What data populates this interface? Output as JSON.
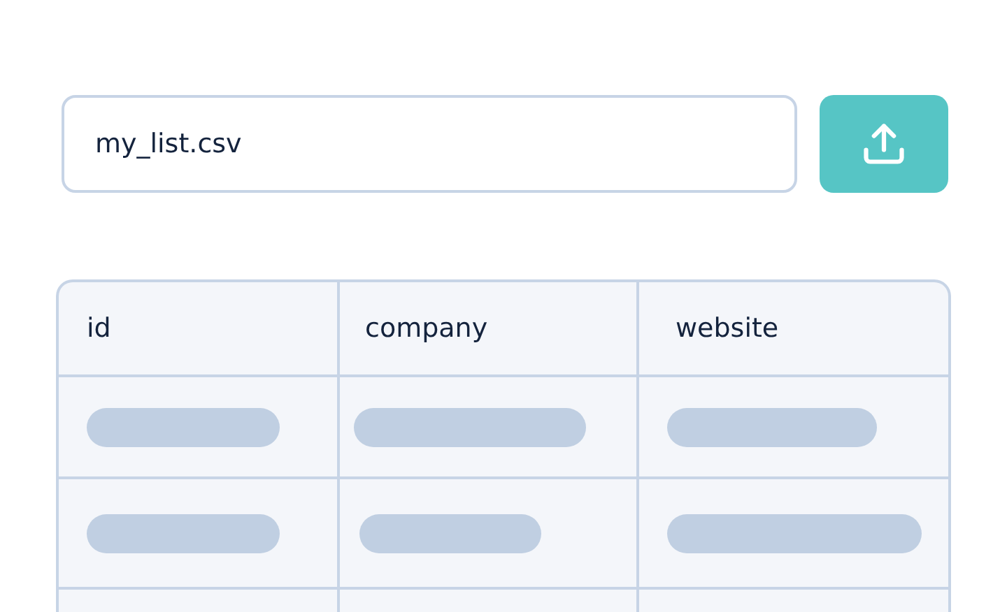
{
  "file_field": {
    "value": "my_list.csv"
  },
  "table": {
    "columns": [
      "id",
      "company",
      "website"
    ]
  }
}
